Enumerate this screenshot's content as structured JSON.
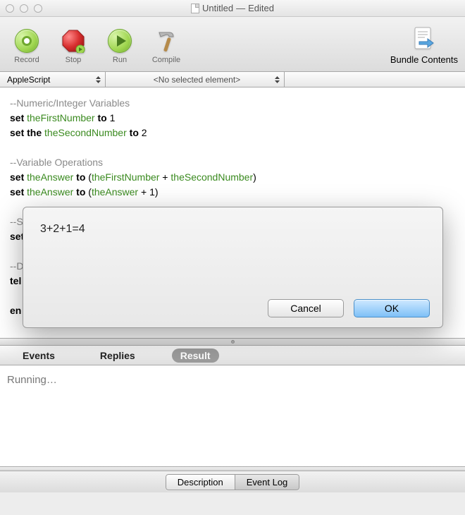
{
  "window": {
    "title": "Untitled",
    "status": "Edited"
  },
  "toolbar": {
    "record": "Record",
    "stop": "Stop",
    "run": "Run",
    "compile": "Compile",
    "bundle": "Bundle Contents"
  },
  "selector": {
    "language": "AppleScript",
    "element": "<No selected element>"
  },
  "code": {
    "l1_comment": "--Numeric/Integer Variables",
    "l2_set": "set ",
    "l2_var": "theFirstNumber",
    "l2_to": " to ",
    "l2_val": "1",
    "l3_set": "set the ",
    "l3_var": "theSecondNumber",
    "l3_to": " to ",
    "l3_val": "2",
    "blank": "",
    "l5_comment": "--Variable Operations",
    "l6_set": "set ",
    "l6_var1": "theAnswer",
    "l6_to": " to ",
    "l6_open": "(",
    "l6_var2": "theFirstNumber",
    "l6_plus": " + ",
    "l6_var3": "theSecondNumber",
    "l6_close": ")",
    "l7_set": "set ",
    "l7_var1": "theAnswer",
    "l7_to": " to ",
    "l7_open": "(",
    "l7_var2": "theAnswer",
    "l7_rest": " + 1)",
    "l9": "--S",
    "l10": "set",
    "l12": "--D",
    "l13": "tel",
    "l15": "en"
  },
  "result_tabs": {
    "events": "Events",
    "replies": "Replies",
    "result": "Result"
  },
  "result_text": "Running…",
  "bottom_tabs": {
    "description": "Description",
    "event_log": "Event Log"
  },
  "dialog": {
    "message": "3+2+1=4",
    "cancel": "Cancel",
    "ok": "OK"
  }
}
